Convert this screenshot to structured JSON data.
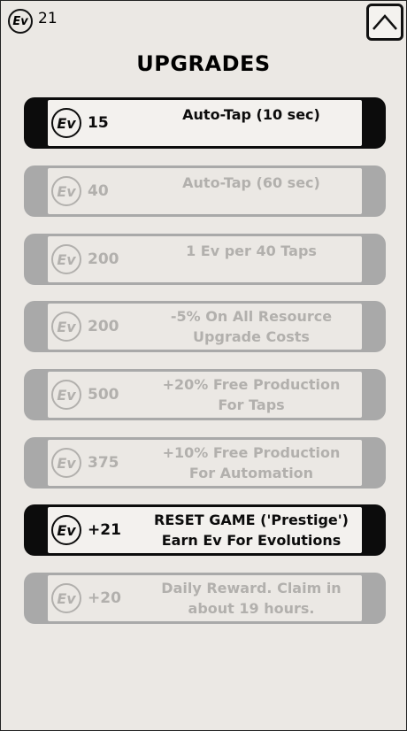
{
  "header": {
    "currency_symbol": "Ev",
    "currency_count": "21",
    "title": "UPGRADES",
    "collapse_icon": "chevron-up-icon"
  },
  "upgrades": [
    {
      "cost": "15",
      "label": "Auto-Tap (10 sec)",
      "state": "active"
    },
    {
      "cost": "40",
      "label": "Auto-Tap (60 sec)",
      "state": "disabled"
    },
    {
      "cost": "200",
      "label": "1 Ev per 40 Taps",
      "state": "disabled"
    },
    {
      "cost": "200",
      "label": "-5% On All Resource\nUpgrade Costs",
      "state": "disabled"
    },
    {
      "cost": "500",
      "label": "+20% Free Production\nFor Taps",
      "state": "disabled"
    },
    {
      "cost": "375",
      "label": "+10% Free Production\nFor Automation",
      "state": "disabled"
    },
    {
      "cost": "+21",
      "label": "RESET GAME ('Prestige')\nEarn Ev For Evolutions",
      "state": "active"
    },
    {
      "cost": "+20",
      "label": "Daily Reward. Claim in\nabout 19 hours.",
      "state": "disabled"
    }
  ],
  "colors": {
    "background": "#ebe8e4",
    "active": "#0c0c0c",
    "disabled_frame": "#a9a9a9",
    "disabled_text": "#b2b0ad"
  }
}
